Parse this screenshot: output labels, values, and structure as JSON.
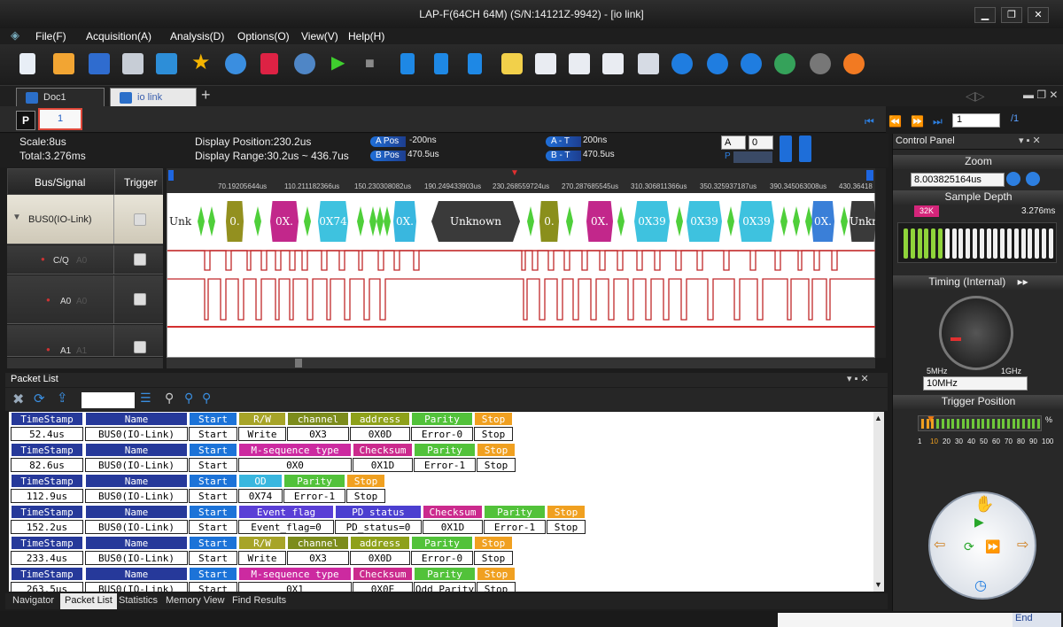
{
  "window": {
    "title": "LAP-F(64CH 64M) (S/N:14121Z-9942) - [io link]"
  },
  "menu": [
    "File(F)",
    "Acquisition(A)",
    "Analysis(D)",
    "Options(O)",
    "View(V)",
    "Help(H)"
  ],
  "tabs": [
    {
      "label": "Doc1"
    },
    {
      "label": "io link"
    }
  ],
  "pager": {
    "p": "P",
    "page": "1",
    "total": "/1"
  },
  "info": {
    "scale": "Scale:8us",
    "total": "Total:3.276ms",
    "display_position": "Display Position:230.2us",
    "display_range": "Display Range:30.2us ~ 436.7us",
    "apos_label": "A Pos",
    "apos_val": "-200ns",
    "bpos_label": "B Pos",
    "bpos_val": "470.5us",
    "at_label": "A - T",
    "at_val": "200ns",
    "bt_label": "B - T",
    "bt_val": "470.5us",
    "sel_a": "A",
    "sel_0": "0",
    "p": "P"
  },
  "signals": {
    "header_bus": "Bus/Signal",
    "header_trigger": "Trigger",
    "rows": [
      {
        "name": "BUS0(IO-Link)"
      },
      {
        "name": "C/Q",
        "ch": "A0"
      },
      {
        "name": "A0",
        "ch": "A0"
      },
      {
        "name": "A1",
        "ch": "A1"
      }
    ]
  },
  "ruler": [
    "70.19205644us",
    "110.211182366us",
    "150.230308082us",
    "190.249433903us",
    "230.268559724us",
    "270.287685545us",
    "310.306811366us",
    "350.325937187us",
    "390.345063008us",
    "430.36418"
  ],
  "decode": [
    "Unk.",
    "0.",
    "0X.",
    "0X74",
    "0X.",
    "Unknown",
    "0.",
    "0X.",
    "0X39",
    "0X39",
    "0X39",
    "0X.",
    "Unkn"
  ],
  "packet_list": {
    "title": "Packet List",
    "packets": [
      {
        "ts": "52.4us",
        "name": "BUS0(IO-Link)",
        "fields": [
          [
            "Start",
            "Start"
          ],
          [
            "R/W",
            "Write"
          ],
          [
            "channel",
            "0X3"
          ],
          [
            "address",
            "0X0D"
          ],
          [
            "Parity",
            "Error-0"
          ],
          [
            "Stop",
            "Stop"
          ]
        ]
      },
      {
        "ts": "82.6us",
        "name": "BUS0(IO-Link)",
        "fields": [
          [
            "Start",
            "Start"
          ],
          [
            "M-sequence type",
            "0X0"
          ],
          [
            "Checksum",
            "0X1D"
          ],
          [
            "Parity",
            "Error-1"
          ],
          [
            "Stop",
            "Stop"
          ]
        ]
      },
      {
        "ts": "112.9us",
        "name": "BUS0(IO-Link)",
        "fields": [
          [
            "Start",
            "Start"
          ],
          [
            "OD",
            "0X74"
          ],
          [
            "Parity",
            "Error-1"
          ],
          [
            "Stop",
            "Stop"
          ]
        ]
      },
      {
        "ts": "152.2us",
        "name": "BUS0(IO-Link)",
        "fields": [
          [
            "Start",
            "Start"
          ],
          [
            "Event flag",
            "Event_flag=0"
          ],
          [
            "PD status",
            "PD_status=0"
          ],
          [
            "Checksum",
            "0X1D"
          ],
          [
            "Parity",
            "Error-1"
          ],
          [
            "Stop",
            "Stop"
          ]
        ]
      },
      {
        "ts": "233.4us",
        "name": "BUS0(IO-Link)",
        "fields": [
          [
            "Start",
            "Start"
          ],
          [
            "R/W",
            "Write"
          ],
          [
            "channel",
            "0X3"
          ],
          [
            "address",
            "0X0D"
          ],
          [
            "Parity",
            "Error-0"
          ],
          [
            "Stop",
            "Stop"
          ]
        ]
      },
      {
        "ts": "263.5us",
        "name": "BUS0(IO-Link)",
        "fields": [
          [
            "Start",
            "Start"
          ],
          [
            "M-sequence type",
            "0X1"
          ],
          [
            "Checksum",
            "0X0E"
          ],
          [
            "Parity",
            "Odd Parity"
          ],
          [
            "Stop",
            "Stop"
          ]
        ]
      }
    ],
    "ts_header": "TimeStamp",
    "name_header": "Name"
  },
  "bottom_tabs": [
    "Navigator",
    "Packet List",
    "Statistics",
    "Memory View",
    "Find Results"
  ],
  "status": {
    "end": "End"
  },
  "control_panel": {
    "title": "Control Panel",
    "zoom": "Zoom",
    "zoom_value": "8.003825164us",
    "sample_depth": "Sample Depth",
    "depth_badge": "32K",
    "depth_value": "3.276ms",
    "timing": "Timing (Internal)",
    "min": "5MHz",
    "max": "1GHz",
    "rate": "10MHz",
    "trigger_position": "Trigger Position",
    "percent": "%",
    "scale": [
      "1",
      "10",
      "20",
      "30",
      "40",
      "50",
      "60",
      "70",
      "80",
      "90",
      "100"
    ]
  },
  "colors": {
    "start": "#1c73d8",
    "rw": "#a7a428",
    "channel": "#7c8c1c",
    "address": "#8ea11a",
    "parity": "#52c23a",
    "stop": "#f0a020",
    "mseq": "#cc2aa0",
    "checksum": "#cb2a8d",
    "od": "#39b7df",
    "event": "#5a3fd6",
    "pd": "#4b3fd0",
    "header": "#26399a"
  }
}
